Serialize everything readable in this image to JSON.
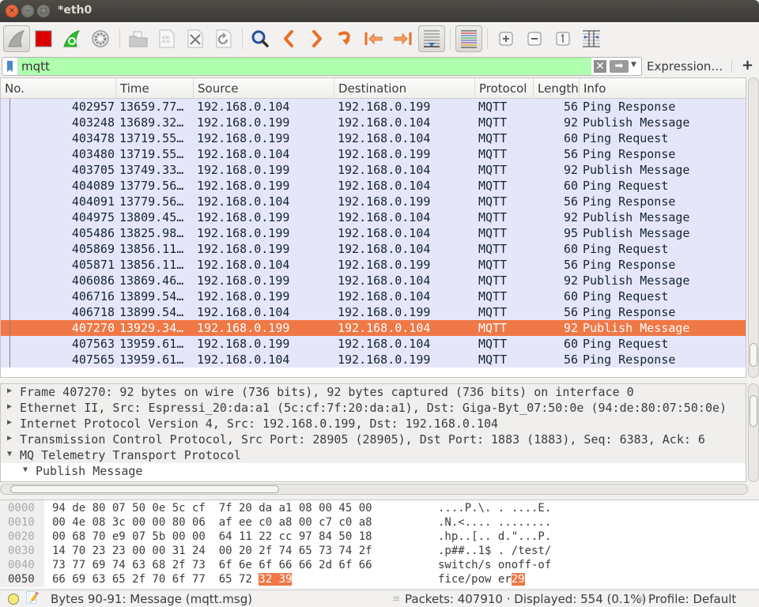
{
  "window": {
    "title": "*eth0",
    "close_glyph": "×",
    "min_glyph": "–",
    "max_glyph": "□"
  },
  "toolbar": {
    "buttons": [
      {
        "name": "start-capture",
        "icon": "shark-fin-icon"
      },
      {
        "name": "stop-capture",
        "icon": "stop-square-icon"
      },
      {
        "name": "restart-capture",
        "icon": "restart-fin-icon"
      },
      {
        "name": "capture-options",
        "icon": "gear-icon"
      },
      {
        "name": "open-file",
        "icon": "folder-icon"
      },
      {
        "name": "save-file",
        "icon": "binary-file-icon"
      },
      {
        "name": "close-file",
        "icon": "close-file-icon"
      },
      {
        "name": "reload-file",
        "icon": "reload-file-icon"
      },
      {
        "name": "find-packet",
        "icon": "magnifier-icon"
      },
      {
        "name": "go-back",
        "icon": "chevron-left-icon"
      },
      {
        "name": "go-forward",
        "icon": "chevron-right-icon"
      },
      {
        "name": "go-to-packet",
        "icon": "jump-arrow-icon"
      },
      {
        "name": "go-first",
        "icon": "first-packet-icon"
      },
      {
        "name": "go-last",
        "icon": "last-packet-icon"
      },
      {
        "name": "autoscroll",
        "icon": "autoscroll-icon"
      },
      {
        "name": "colorize",
        "icon": "colorize-lines-icon"
      },
      {
        "name": "zoom-in",
        "icon": "zoom-in-icon"
      },
      {
        "name": "zoom-out",
        "icon": "zoom-out-icon"
      },
      {
        "name": "normal-size",
        "icon": "normal-size-icon"
      },
      {
        "name": "resize-columns",
        "icon": "resize-columns-icon"
      }
    ]
  },
  "filter": {
    "value": "mqtt",
    "clear_glyph": "✕",
    "apply_glyph": "➡",
    "dropdown_glyph": "▼",
    "expression_label": "Expression…",
    "add_label": "+",
    "bg_color": "#afffaf"
  },
  "packet_list": {
    "columns": [
      "No.",
      "Time",
      "Source",
      "Destination",
      "Protocol",
      "Length",
      "Info"
    ],
    "selected_color": "#f07746",
    "row_color": "#e6e6fb",
    "rows": [
      {
        "no": "402957",
        "time": "13659.77…",
        "src": "192.168.0.104",
        "dst": "192.168.0.199",
        "proto": "MQTT",
        "len": "56",
        "info": "Ping Response"
      },
      {
        "no": "403248",
        "time": "13689.32…",
        "src": "192.168.0.199",
        "dst": "192.168.0.104",
        "proto": "MQTT",
        "len": "92",
        "info": "Publish Message"
      },
      {
        "no": "403478",
        "time": "13719.55…",
        "src": "192.168.0.199",
        "dst": "192.168.0.104",
        "proto": "MQTT",
        "len": "60",
        "info": "Ping Request"
      },
      {
        "no": "403480",
        "time": "13719.55…",
        "src": "192.168.0.104",
        "dst": "192.168.0.199",
        "proto": "MQTT",
        "len": "56",
        "info": "Ping Response"
      },
      {
        "no": "403705",
        "time": "13749.33…",
        "src": "192.168.0.199",
        "dst": "192.168.0.104",
        "proto": "MQTT",
        "len": "92",
        "info": "Publish Message"
      },
      {
        "no": "404089",
        "time": "13779.56…",
        "src": "192.168.0.199",
        "dst": "192.168.0.104",
        "proto": "MQTT",
        "len": "60",
        "info": "Ping Request"
      },
      {
        "no": "404091",
        "time": "13779.56…",
        "src": "192.168.0.104",
        "dst": "192.168.0.199",
        "proto": "MQTT",
        "len": "56",
        "info": "Ping Response"
      },
      {
        "no": "404975",
        "time": "13809.45…",
        "src": "192.168.0.199",
        "dst": "192.168.0.104",
        "proto": "MQTT",
        "len": "92",
        "info": "Publish Message"
      },
      {
        "no": "405486",
        "time": "13825.98…",
        "src": "192.168.0.199",
        "dst": "192.168.0.104",
        "proto": "MQTT",
        "len": "95",
        "info": "Publish Message"
      },
      {
        "no": "405869",
        "time": "13856.11…",
        "src": "192.168.0.199",
        "dst": "192.168.0.104",
        "proto": "MQTT",
        "len": "60",
        "info": "Ping Request"
      },
      {
        "no": "405871",
        "time": "13856.11…",
        "src": "192.168.0.104",
        "dst": "192.168.0.199",
        "proto": "MQTT",
        "len": "56",
        "info": "Ping Response"
      },
      {
        "no": "406086",
        "time": "13869.46…",
        "src": "192.168.0.199",
        "dst": "192.168.0.104",
        "proto": "MQTT",
        "len": "92",
        "info": "Publish Message"
      },
      {
        "no": "406716",
        "time": "13899.54…",
        "src": "192.168.0.199",
        "dst": "192.168.0.104",
        "proto": "MQTT",
        "len": "60",
        "info": "Ping Request"
      },
      {
        "no": "406718",
        "time": "13899.54…",
        "src": "192.168.0.104",
        "dst": "192.168.0.199",
        "proto": "MQTT",
        "len": "56",
        "info": "Ping Response"
      },
      {
        "no": "407270",
        "time": "13929.34…",
        "src": "192.168.0.199",
        "dst": "192.168.0.104",
        "proto": "MQTT",
        "len": "92",
        "info": "Publish Message",
        "selected": true
      },
      {
        "no": "407563",
        "time": "13959.61…",
        "src": "192.168.0.199",
        "dst": "192.168.0.104",
        "proto": "MQTT",
        "len": "60",
        "info": "Ping Request"
      },
      {
        "no": "407565",
        "time": "13959.61…",
        "src": "192.168.0.104",
        "dst": "192.168.0.199",
        "proto": "MQTT",
        "len": "56",
        "info": "Ping Response"
      }
    ]
  },
  "details": {
    "rows": [
      {
        "text": "Frame 407270: 92 bytes on wire (736 bits), 92 bytes captured (736 bits) on interface 0",
        "expanded": false,
        "indent": 0
      },
      {
        "text": "Ethernet II, Src: Espressi_20:da:a1 (5c:cf:7f:20:da:a1), Dst: Giga-Byt_07:50:0e (94:de:80:07:50:0e)",
        "expanded": false,
        "indent": 0
      },
      {
        "text": "Internet Protocol Version 4, Src: 192.168.0.199, Dst: 192.168.0.104",
        "expanded": false,
        "indent": 0
      },
      {
        "text": "Transmission Control Protocol, Src Port: 28905 (28905), Dst Port: 1883 (1883), Seq: 6383, Ack: 6",
        "expanded": false,
        "indent": 0
      },
      {
        "text": "MQ Telemetry Transport Protocol",
        "expanded": true,
        "indent": 0
      },
      {
        "text": "Publish Message",
        "expanded": true,
        "indent": 1
      }
    ],
    "collapsed_glyph": "▶",
    "expanded_glyph": "▼"
  },
  "bytes": {
    "rows": [
      {
        "offset": "0000",
        "hex": "94 de 80 07 50 0e 5c cf  7f 20 da a1 08 00 45 00",
        "ascii": "....P.\\. . ....E."
      },
      {
        "offset": "0010",
        "hex": "00 4e 08 3c 00 00 80 06  af ee c0 a8 00 c7 c0 a8",
        "ascii": ".N.<.... ........"
      },
      {
        "offset": "0020",
        "hex": "00 68 70 e9 07 5b 00 00  64 11 22 cc 97 84 50 18",
        "ascii": ".hp..[.. d.\"...P."
      },
      {
        "offset": "0030",
        "hex": "14 70 23 23 00 00 31 24  00 20 2f 74 65 73 74 2f",
        "ascii": ".p##..1$ . /test/"
      },
      {
        "offset": "0040",
        "hex": "73 77 69 74 63 68 2f 73  6f 6e 6f 66 66 2d 6f 66",
        "ascii": "switch/s onoff-of"
      },
      {
        "offset": "0050",
        "hex": "66 69 63 65 2f 70 6f 77  65 72 ",
        "hex_hl": "32 39",
        "ascii": "fice/pow er",
        "ascii_hl": "29"
      }
    ]
  },
  "status": {
    "message": "Bytes 90-91: Message (mqtt.msg)",
    "packets": "Packets: 407910 · Displayed: 554 (0.1%)",
    "profile": "Profile: Default",
    "grip_glyph": "≡"
  }
}
